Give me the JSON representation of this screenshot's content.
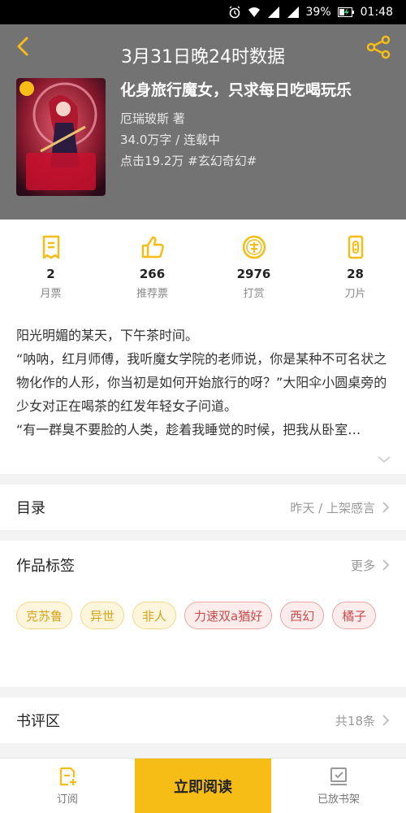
{
  "status_bar": {
    "battery": "39%",
    "time": "01:48"
  },
  "header": {
    "title": "3月31日晚24时数据",
    "book_title": "化身旅行魔女，只求每日吃喝玩乐",
    "author": "厄瑞玻斯 著",
    "words_status": "34.0万字 / 连载中",
    "clicks_genre": "点击19.2万 #玄幻奇幻#"
  },
  "stats": [
    {
      "value": "2",
      "label": "月票",
      "icon": "monthly-ticket-icon"
    },
    {
      "value": "266",
      "label": "推荐票",
      "icon": "thumbs-up-icon"
    },
    {
      "value": "2976",
      "label": "打赏",
      "icon": "reward-coin-icon"
    },
    {
      "value": "28",
      "label": "刀片",
      "icon": "blade-icon"
    }
  ],
  "description": {
    "lines": [
      "阳光明媚的某天，下午茶时间。",
      "“呐呐，红月师傅，我听魔女学院的老师说，你是某种不可名状之物化作的人形，你当初是如何开始旅行的呀？”大阳伞小圆桌旁的少女对正在喝茶的红发年轻女子问道。",
      "“有一群臭不要脸的人类，趁着我睡觉的时候，把我从卧室…"
    ]
  },
  "toc": {
    "label": "目录",
    "value": "昨天 / 上架感言"
  },
  "tags": {
    "label": "作品标签",
    "more": "更多",
    "items": [
      {
        "text": "克苏鲁",
        "style": "yellow"
      },
      {
        "text": "异世",
        "style": "yellow"
      },
      {
        "text": "非人",
        "style": "yellow"
      },
      {
        "text": "力速双a猶好",
        "style": "red"
      },
      {
        "text": "西幻",
        "style": "red"
      },
      {
        "text": "橘子",
        "style": "red"
      }
    ]
  },
  "reviews": {
    "label": "书评区",
    "count": "共18条"
  },
  "bottom_bar": {
    "subscribe": "订阅",
    "read_now": "立即阅读",
    "shelf": "已放书架"
  },
  "colors": {
    "accent": "#f6bd16",
    "header_bg": "#737373"
  }
}
